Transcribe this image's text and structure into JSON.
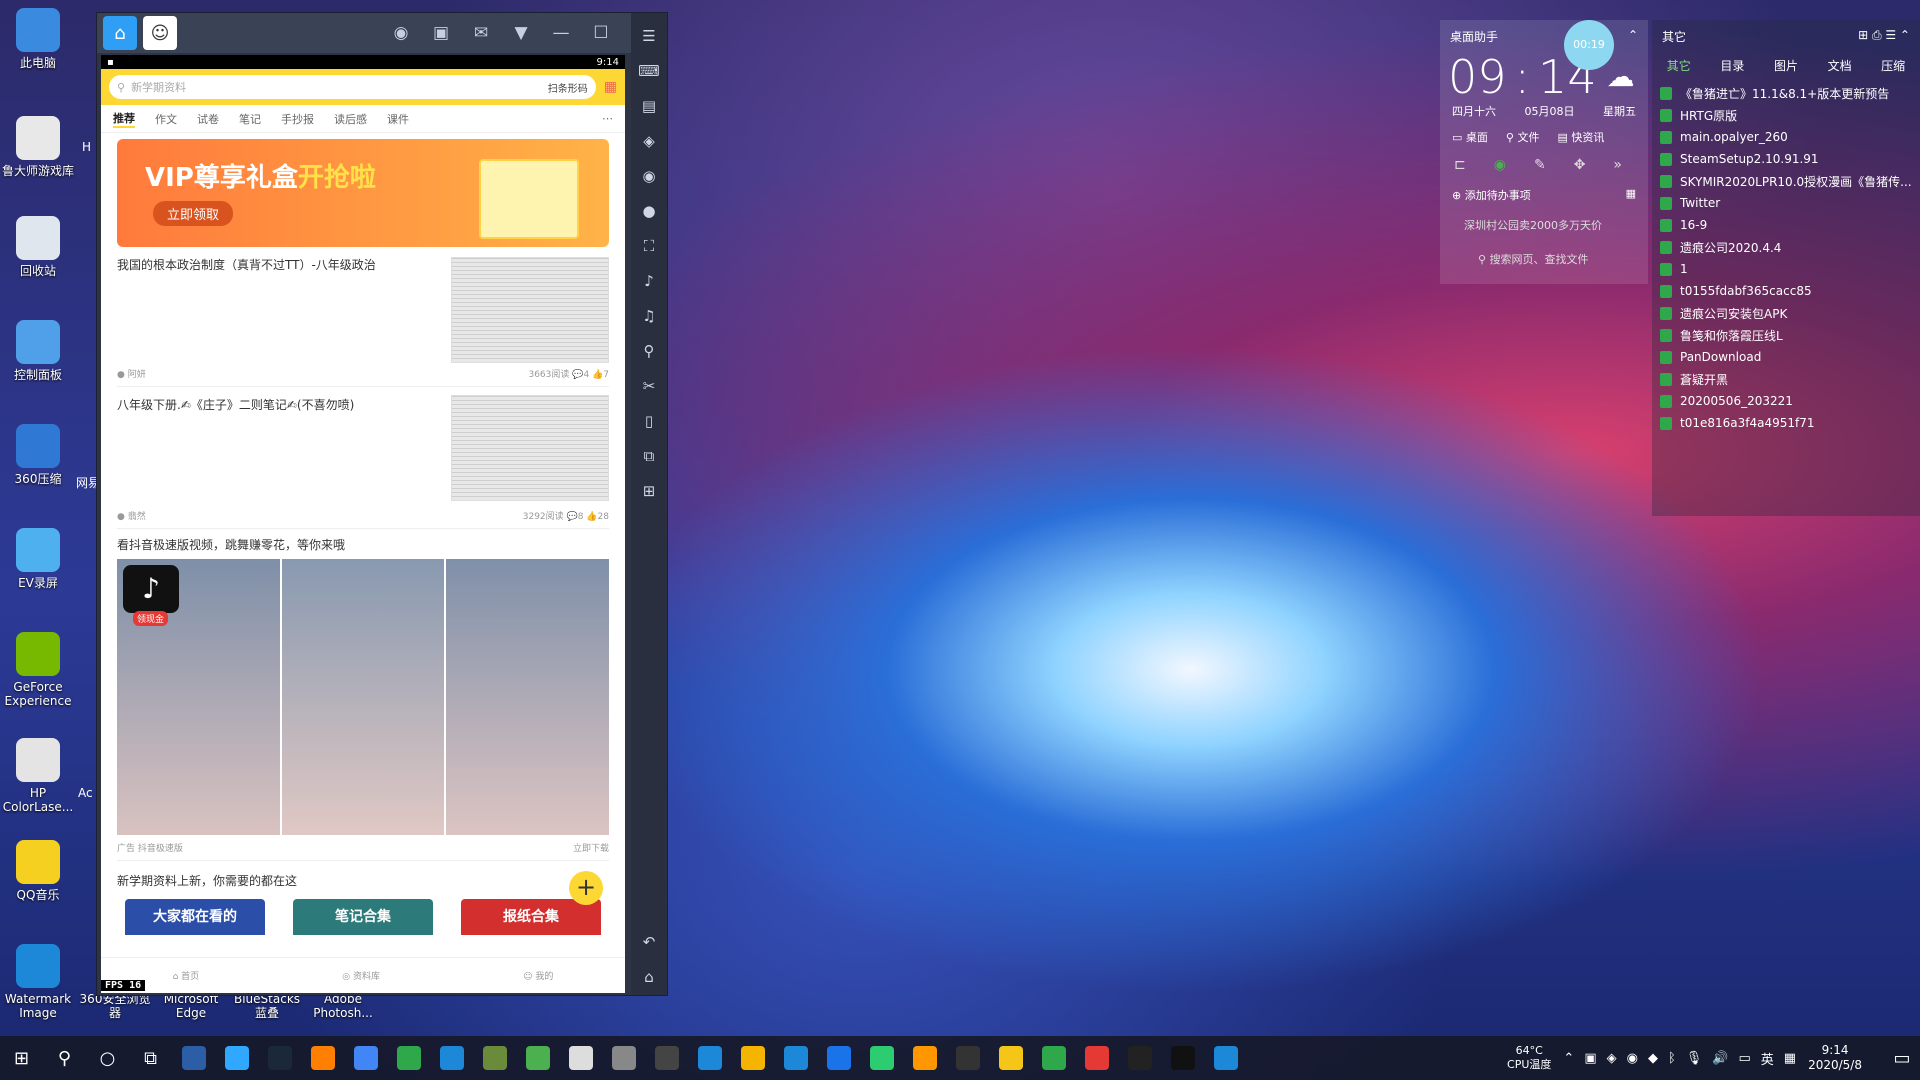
{
  "desktop_icons": [
    {
      "label": "此电脑",
      "color": "#3a8ae0"
    },
    {
      "label": "鲁大师游戏库",
      "color": "#e8e8e8"
    },
    {
      "label": "回收站",
      "color": "#dfe6ee"
    },
    {
      "label": "控制面板",
      "color": "#4fa0e8"
    },
    {
      "label": "360压缩",
      "color": "#2f79d4"
    },
    {
      "label": "EV录屏",
      "color": "#4fb0f0"
    },
    {
      "label": "GeForce Experience",
      "color": "#76b900"
    },
    {
      "label": "HP ColorLase...",
      "color": "#e4e4e4"
    },
    {
      "label": "QQ音乐",
      "color": "#f5d020"
    },
    {
      "label": "Watermark Image",
      "color": "#1e88d8"
    }
  ],
  "desktop_cut_labels": [
    "H",
    "网易",
    "Ac"
  ],
  "desktop_bottom_labels": [
    "360安全浏览器",
    "Microsoft Edge",
    "BlueStacks蓝叠",
    "Adobe Photosh..."
  ],
  "emulator": {
    "status_time": "9:14",
    "search_placeholder": "新学期资料",
    "scan_label": "扫条形码",
    "tabs": [
      "推荐",
      "作文",
      "试卷",
      "笔记",
      "手抄报",
      "读后感",
      "课件"
    ],
    "banner": {
      "title_part1": "VIP尊享礼盒",
      "title_part2": "开抢啦",
      "button": "立即领取"
    },
    "cards": [
      {
        "title": "我国的根本政治制度（真背不过TT）-八年级政治",
        "author": "阿妍",
        "views": "3663阅读",
        "comments": "4",
        "likes": "7"
      },
      {
        "title": "八年级下册.✍《庄子》二则笔记✍(不喜勿喷)",
        "author": "翡然",
        "views": "3292阅读",
        "comments": "8",
        "likes": "28"
      }
    ],
    "ad": {
      "title": "看抖音极速版视频，跳舞赚零花，等你来哦",
      "badge": "领现金",
      "footer_left": "广告 抖音极速版",
      "footer_right": "立即下载"
    },
    "section_title": "新学期资料上新，你需要的都在这",
    "collections": [
      "大家都在看的",
      "笔记合集",
      "报纸合集"
    ],
    "fps_label": "FPS",
    "fps_value": "16",
    "bottom_nav": [
      "首页",
      "资料库",
      "我的"
    ]
  },
  "clock_widget": {
    "title": "桌面助手",
    "timer_badge": "00:19",
    "time_h": "09",
    "time_m": "14",
    "lunar": "四月十六",
    "date": "05月08日",
    "weekday": "星期五",
    "actions": [
      "桌面",
      "文件",
      "快资讯"
    ],
    "todo": "添加待办事项",
    "news": "深圳村公园卖2000多万天价",
    "search": "搜索网页、查找文件"
  },
  "files_widget": {
    "title": "其它",
    "tabs": [
      "其它",
      "目录",
      "图片",
      "文档",
      "压缩"
    ],
    "items": [
      "《鲁猪进亡》11.1&8.1+版本更新预告",
      "HRTG原版",
      "main.opalyer_260",
      "SteamSetup2.10.91.91",
      "SKYMIR2020LPR10.0授权漫画《鲁猪传...",
      "Twitter",
      "16-9",
      "遗痕公司2020.4.4",
      "1",
      "t0155fdabf365cacc85",
      "遗痕公司安装包APK",
      "鲁笺和你落霞压线L",
      "PanDownload",
      "蒼疑开黑",
      "20200506_203221",
      "t01e816a3f4a4951f71"
    ]
  },
  "taskbar": {
    "cpu_temp": "64°C",
    "cpu_label": "CPU温度",
    "ime": "英",
    "time": "9:14",
    "date": "2020/5/8",
    "app_colors": [
      "#2c5ea8",
      "#31a8ff",
      "#1b2838",
      "#ff7f00",
      "#4285f4",
      "#2ea84a",
      "#1e88d8",
      "#6a8b3a",
      "#4caf50",
      "#dddddd",
      "#888888",
      "#444444",
      "#1e88d8",
      "#f4b400",
      "#1e88d8",
      "#1a73e8",
      "#2ecc71",
      "#ff9800",
      "#333333",
      "#f5c518",
      "#2ea84a",
      "#e53935",
      "#222222",
      "#111111",
      "#1e88d8"
    ]
  }
}
